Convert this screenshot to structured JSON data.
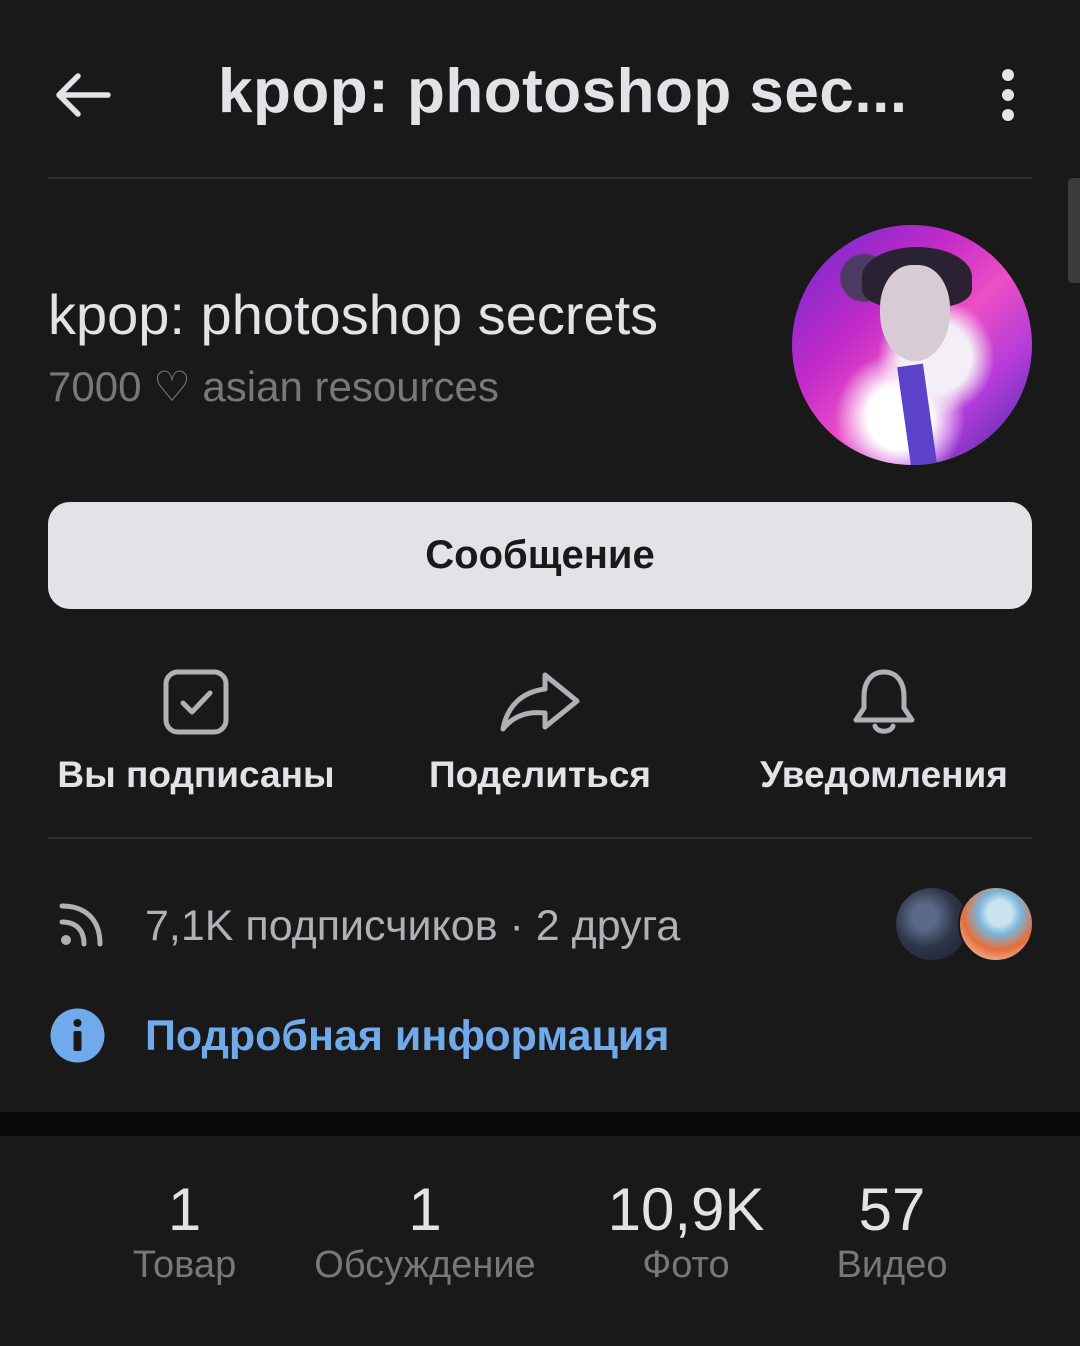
{
  "header": {
    "title": "kpop: photoshop sec...",
    "back_icon": "arrow-left-icon",
    "more_icon": "more-vertical-icon"
  },
  "group": {
    "name": "kpop: photoshop secrets",
    "status": "7000 ♡ asian resources"
  },
  "message_button": {
    "label": "Сообщение"
  },
  "actions": [
    {
      "label": "Вы подписаны",
      "icon": "checkbox-checked-icon"
    },
    {
      "label": "Поделиться",
      "icon": "share-arrow-icon"
    },
    {
      "label": "Уведомления",
      "icon": "bell-icon"
    }
  ],
  "subscribers": {
    "text": "7,1K подписчиков · 2 друга",
    "icon": "rss-icon"
  },
  "info": {
    "text": "Подробная информация",
    "icon": "info-icon"
  },
  "counters": [
    {
      "value": "1",
      "label": "Товар"
    },
    {
      "value": "1",
      "label": "Обсуждение"
    },
    {
      "value": "10,9K",
      "label": "Фото"
    },
    {
      "value": "57",
      "label": "Видео"
    }
  ],
  "colors": {
    "background": "#19191a",
    "text": "#e1e3e6",
    "secondary_text": "#76787a",
    "link": "#71aaeb",
    "button_bg": "#e1e3e6"
  }
}
